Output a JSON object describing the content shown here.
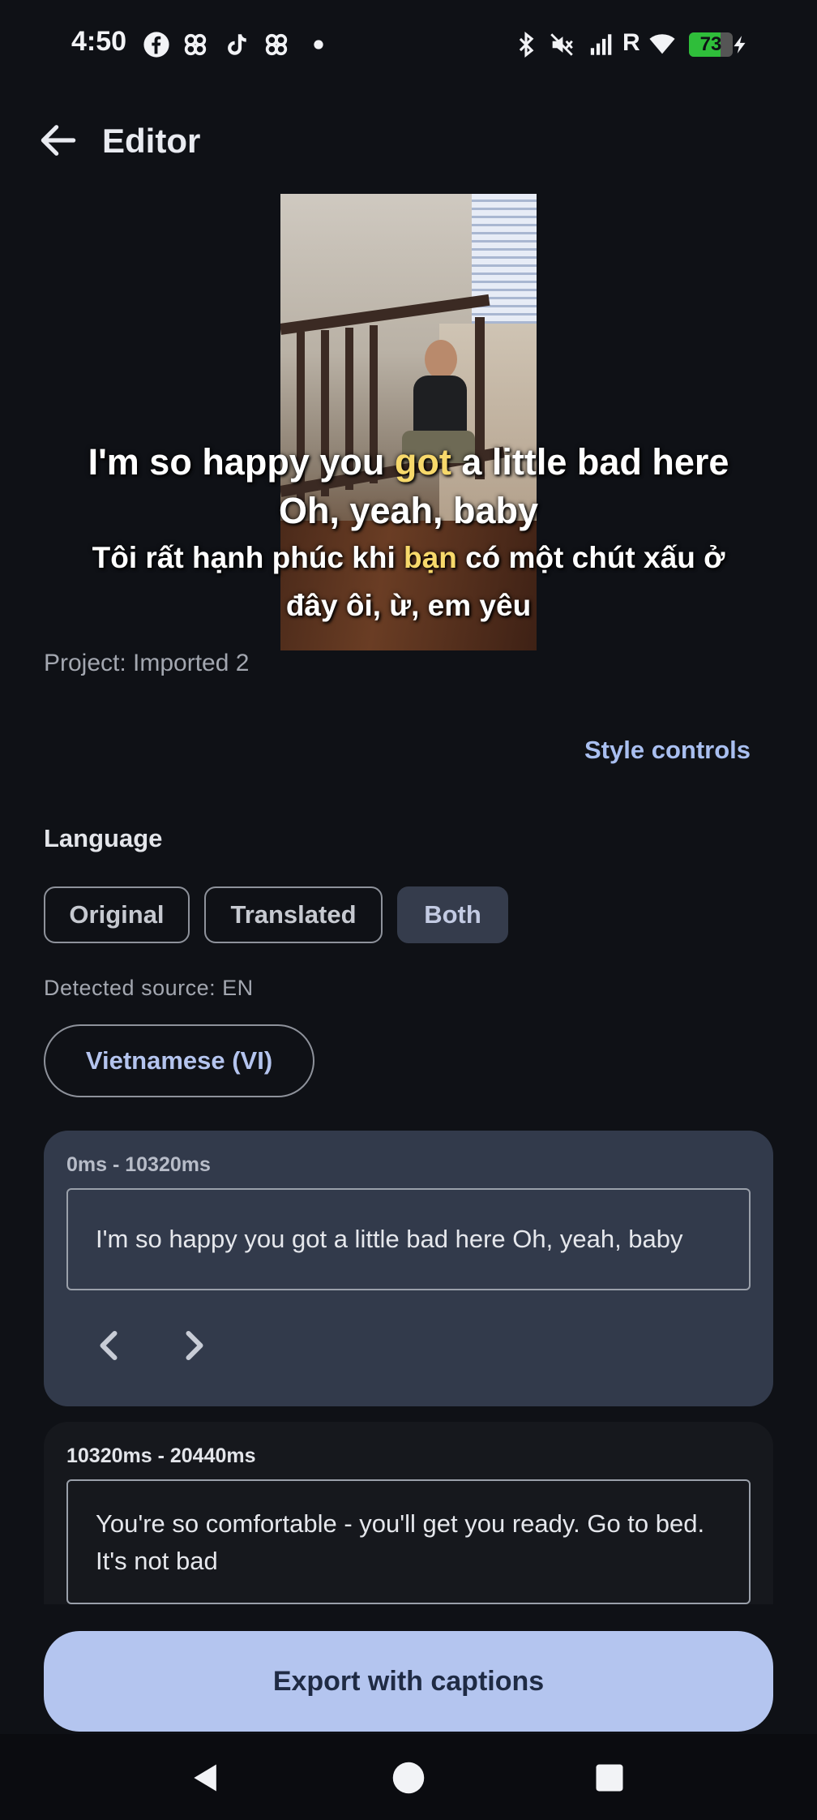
{
  "status_bar": {
    "time": "4:50",
    "battery": "73",
    "signal_label": "R",
    "icons": [
      "facebook-icon",
      "pinwheel-icon",
      "tiktok-icon",
      "pinwheel-icon",
      "dot-icon",
      "bluetooth-icon",
      "mute-icon",
      "signal-icon",
      "wifi-icon",
      "battery-icon",
      "charging-icon"
    ]
  },
  "app_bar": {
    "title": "Editor",
    "back_icon": "arrow-back-icon"
  },
  "preview": {
    "caption_en_pre": "I'm so happy you ",
    "caption_en_hl": "got",
    "caption_en_post": " a little bad here",
    "caption_en_line2": "Oh, yeah, baby",
    "caption_vi_pre": "Tôi rất hạnh phúc khi ",
    "caption_vi_hl": "bạn",
    "caption_vi_post": " có một chút xấu ở",
    "caption_vi_line2": "đây ôi, ừ, em yêu"
  },
  "project": {
    "label": "Project: Imported 2"
  },
  "style_controls": {
    "label": "Style controls"
  },
  "language": {
    "label": "Language",
    "options": [
      "Original",
      "Translated",
      "Both"
    ],
    "selected": "Both",
    "detected": "Detected source: EN",
    "target": "Vietnamese (VI)"
  },
  "segments": [
    {
      "time": "0ms - 10320ms",
      "text": "I'm so happy you got a little bad here Oh, yeah, baby"
    },
    {
      "time": "10320ms - 20440ms",
      "text": "You're so comfortable - you'll get you ready. Go to bed. It's not bad"
    }
  ],
  "export": {
    "label": "Export with captions"
  },
  "colors": {
    "background": "#0f1116",
    "accent": "#b4c5ef",
    "highlight": "#f7d96b",
    "selected_chip": "#353c4c"
  }
}
